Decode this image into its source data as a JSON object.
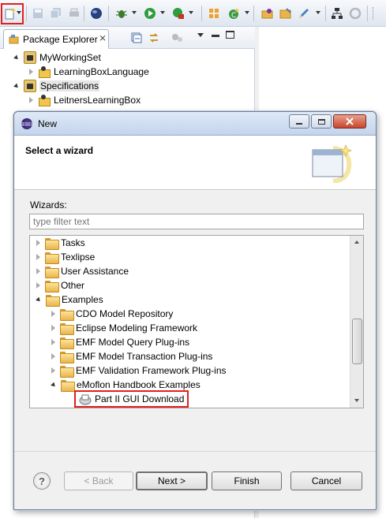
{
  "toolbar": {
    "icons": [
      "new-wizard-icon",
      "save-icon",
      "save-all-icon",
      "print-icon",
      "globe-icon",
      "debug-icon",
      "run-icon",
      "external-tools-icon",
      "new-class-icon",
      "new-java-icon",
      "open-type-icon",
      "edit-icon",
      "hierarchy-icon",
      "refresh-icon"
    ]
  },
  "package_explorer": {
    "tab_label": "Package Explorer",
    "close_glyph": "⨯",
    "tree": [
      {
        "label": "MyWorkingSet",
        "level": 0,
        "expanded": true
      },
      {
        "label": "LearningBoxLanguage",
        "level": 1,
        "expanded": false
      },
      {
        "label": "Specifications",
        "level": 0,
        "expanded": true
      },
      {
        "label": "LeitnersLearningBox",
        "level": 1,
        "expanded": false
      }
    ]
  },
  "dialog": {
    "title": "New",
    "banner_heading": "Select a wizard",
    "wizards_label": "Wizards:",
    "filter_placeholder": "type filter text",
    "items": [
      {
        "label": "Tasks",
        "level": 0,
        "expanded": false
      },
      {
        "label": "Texlipse",
        "level": 0,
        "expanded": false
      },
      {
        "label": "User Assistance",
        "level": 0,
        "expanded": false
      },
      {
        "label": "Other",
        "level": 0,
        "expanded": false
      },
      {
        "label": "Examples",
        "level": 0,
        "expanded": true
      },
      {
        "label": "CDO Model Repository",
        "level": 1,
        "expanded": false
      },
      {
        "label": "Eclipse Modeling Framework",
        "level": 1,
        "expanded": false
      },
      {
        "label": "EMF Model Query Plug-ins",
        "level": 1,
        "expanded": false
      },
      {
        "label": "EMF Model Transaction Plug-ins",
        "level": 1,
        "expanded": false
      },
      {
        "label": "EMF Validation Framework Plug-ins",
        "level": 1,
        "expanded": false
      },
      {
        "label": "eMoflon Handbook Examples",
        "level": 1,
        "expanded": true
      },
      {
        "label": "Part II GUI Download",
        "level": 2,
        "expanded": false,
        "highlighted": true
      }
    ],
    "buttons": {
      "help_glyph": "?",
      "back": "< Back",
      "next": "Next >",
      "finish": "Finish",
      "cancel": "Cancel"
    }
  },
  "colors": {
    "highlight_red": "#e0201c"
  }
}
